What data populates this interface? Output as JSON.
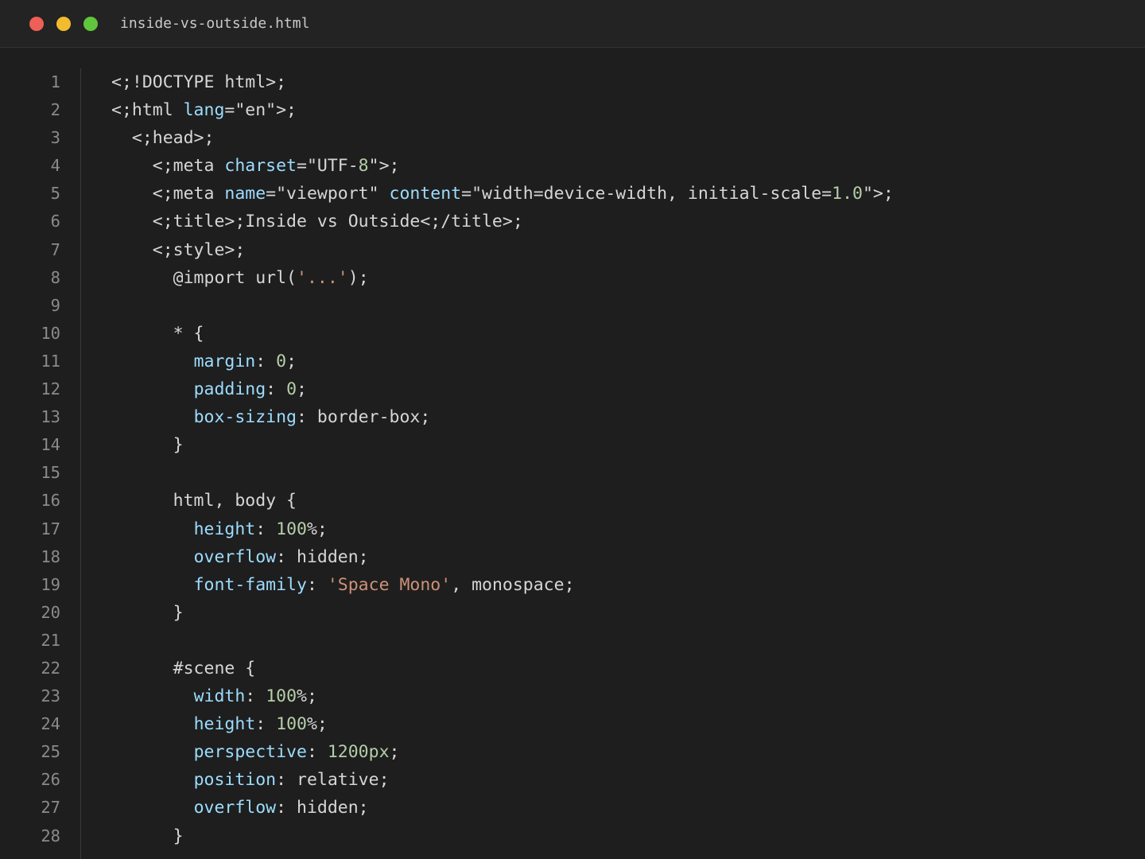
{
  "window": {
    "filename": "inside-vs-outside.html",
    "colors": {
      "close": "#ee5f57",
      "minimize": "#f2bc2e",
      "maximize": "#5fc63d"
    }
  },
  "colors": {
    "plain": "#d6d6d6",
    "attribute": "#9cdcfe",
    "number": "#b5cea8",
    "string": "#ce9178",
    "line_number": "#8a8a8a"
  },
  "editor": {
    "lines": [
      {
        "n": "1",
        "indent": 0,
        "tokens": [
          {
            "t": "plain",
            "v": "<;!DOCTYPE html>;"
          }
        ]
      },
      {
        "n": "2",
        "indent": 0,
        "tokens": [
          {
            "t": "plain",
            "v": "<;html "
          },
          {
            "t": "attr",
            "v": "lang"
          },
          {
            "t": "plain",
            "v": "=\"en\">;"
          }
        ]
      },
      {
        "n": "3",
        "indent": 1,
        "tokens": [
          {
            "t": "plain",
            "v": "<;head>;"
          }
        ]
      },
      {
        "n": "4",
        "indent": 2,
        "tokens": [
          {
            "t": "plain",
            "v": "<;meta "
          },
          {
            "t": "attr",
            "v": "charset"
          },
          {
            "t": "plain",
            "v": "=\"UTF-"
          },
          {
            "t": "num",
            "v": "8"
          },
          {
            "t": "plain",
            "v": "\">;"
          }
        ]
      },
      {
        "n": "5",
        "indent": 2,
        "tokens": [
          {
            "t": "plain",
            "v": "<;meta "
          },
          {
            "t": "attr",
            "v": "name"
          },
          {
            "t": "plain",
            "v": "=\"viewport\" "
          },
          {
            "t": "attr",
            "v": "content"
          },
          {
            "t": "plain",
            "v": "=\"width=device-width, initial-scale="
          },
          {
            "t": "num",
            "v": "1.0"
          },
          {
            "t": "plain",
            "v": "\">;"
          }
        ]
      },
      {
        "n": "6",
        "indent": 2,
        "tokens": [
          {
            "t": "plain",
            "v": "<;title>;Inside vs Outside<;/title>;"
          }
        ]
      },
      {
        "n": "7",
        "indent": 2,
        "tokens": [
          {
            "t": "plain",
            "v": "<;style>;"
          }
        ]
      },
      {
        "n": "8",
        "indent": 3,
        "tokens": [
          {
            "t": "plain",
            "v": "@import url("
          },
          {
            "t": "str",
            "v": "'...'"
          },
          {
            "t": "plain",
            "v": ");"
          }
        ]
      },
      {
        "n": "9",
        "indent": 0,
        "tokens": []
      },
      {
        "n": "10",
        "indent": 3,
        "tokens": [
          {
            "t": "plain",
            "v": "* {"
          }
        ]
      },
      {
        "n": "11",
        "indent": 4,
        "tokens": [
          {
            "t": "prop",
            "v": "margin"
          },
          {
            "t": "plain",
            "v": ": "
          },
          {
            "t": "num",
            "v": "0"
          },
          {
            "t": "plain",
            "v": ";"
          }
        ]
      },
      {
        "n": "12",
        "indent": 4,
        "tokens": [
          {
            "t": "prop",
            "v": "padding"
          },
          {
            "t": "plain",
            "v": ": "
          },
          {
            "t": "num",
            "v": "0"
          },
          {
            "t": "plain",
            "v": ";"
          }
        ]
      },
      {
        "n": "13",
        "indent": 4,
        "tokens": [
          {
            "t": "prop",
            "v": "box-sizing"
          },
          {
            "t": "plain",
            "v": ": border-box;"
          }
        ]
      },
      {
        "n": "14",
        "indent": 3,
        "tokens": [
          {
            "t": "plain",
            "v": "}"
          }
        ]
      },
      {
        "n": "15",
        "indent": 0,
        "tokens": []
      },
      {
        "n": "16",
        "indent": 3,
        "tokens": [
          {
            "t": "plain",
            "v": "html, body {"
          }
        ]
      },
      {
        "n": "17",
        "indent": 4,
        "tokens": [
          {
            "t": "prop",
            "v": "height"
          },
          {
            "t": "plain",
            "v": ": "
          },
          {
            "t": "num",
            "v": "100"
          },
          {
            "t": "plain",
            "v": "%;"
          }
        ]
      },
      {
        "n": "18",
        "indent": 4,
        "tokens": [
          {
            "t": "prop",
            "v": "overflow"
          },
          {
            "t": "plain",
            "v": ": hidden;"
          }
        ]
      },
      {
        "n": "19",
        "indent": 4,
        "tokens": [
          {
            "t": "prop",
            "v": "font-family"
          },
          {
            "t": "plain",
            "v": ": "
          },
          {
            "t": "str",
            "v": "'Space Mono'"
          },
          {
            "t": "plain",
            "v": ", monospace;"
          }
        ]
      },
      {
        "n": "20",
        "indent": 3,
        "tokens": [
          {
            "t": "plain",
            "v": "}"
          }
        ]
      },
      {
        "n": "21",
        "indent": 0,
        "tokens": []
      },
      {
        "n": "22",
        "indent": 3,
        "tokens": [
          {
            "t": "plain",
            "v": "#scene {"
          }
        ]
      },
      {
        "n": "23",
        "indent": 4,
        "tokens": [
          {
            "t": "prop",
            "v": "width"
          },
          {
            "t": "plain",
            "v": ": "
          },
          {
            "t": "num",
            "v": "100"
          },
          {
            "t": "plain",
            "v": "%;"
          }
        ]
      },
      {
        "n": "24",
        "indent": 4,
        "tokens": [
          {
            "t": "prop",
            "v": "height"
          },
          {
            "t": "plain",
            "v": ": "
          },
          {
            "t": "num",
            "v": "100"
          },
          {
            "t": "plain",
            "v": "%;"
          }
        ]
      },
      {
        "n": "25",
        "indent": 4,
        "tokens": [
          {
            "t": "prop",
            "v": "perspective"
          },
          {
            "t": "plain",
            "v": ": "
          },
          {
            "t": "num",
            "v": "1200px"
          },
          {
            "t": "plain",
            "v": ";"
          }
        ]
      },
      {
        "n": "26",
        "indent": 4,
        "tokens": [
          {
            "t": "prop",
            "v": "position"
          },
          {
            "t": "plain",
            "v": ": relative;"
          }
        ]
      },
      {
        "n": "27",
        "indent": 4,
        "tokens": [
          {
            "t": "prop",
            "v": "overflow"
          },
          {
            "t": "plain",
            "v": ": hidden;"
          }
        ]
      },
      {
        "n": "28",
        "indent": 3,
        "tokens": [
          {
            "t": "plain",
            "v": "}"
          }
        ]
      }
    ]
  }
}
